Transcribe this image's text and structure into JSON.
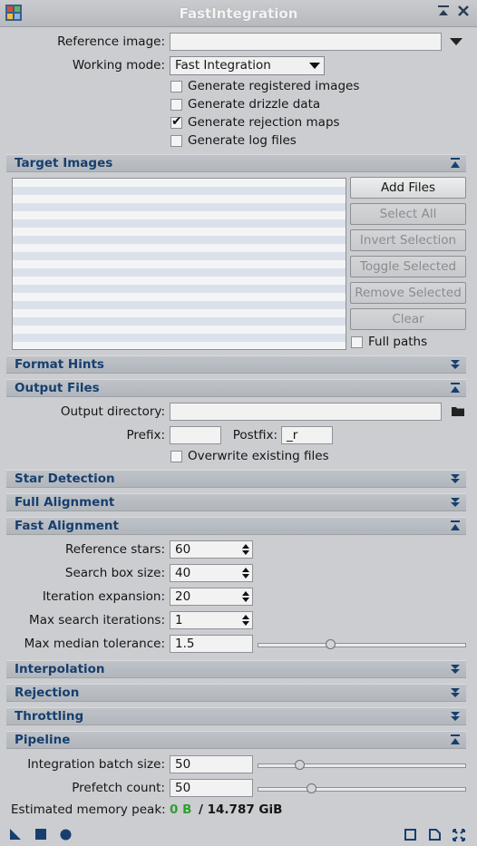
{
  "window": {
    "title": "FastIntegration",
    "accent": "#173f6e"
  },
  "form": {
    "reference_label": "Reference image:",
    "reference_value": "",
    "working_mode_label": "Working mode:",
    "working_mode_value": "Fast Integration",
    "options": [
      {
        "label": "Generate registered images",
        "checked": false
      },
      {
        "label": "Generate drizzle data",
        "checked": false
      },
      {
        "label": "Generate rejection maps",
        "checked": true
      },
      {
        "label": "Generate log files",
        "checked": false
      }
    ]
  },
  "sections": {
    "target_images": "Target Images",
    "format_hints": "Format Hints",
    "output_files": "Output Files",
    "star_detection": "Star Detection",
    "full_alignment": "Full Alignment",
    "fast_alignment": "Fast Alignment",
    "interpolation": "Interpolation",
    "rejection": "Rejection",
    "throttling": "Throttling",
    "pipeline": "Pipeline"
  },
  "target_images": {
    "buttons": {
      "add_files": "Add Files",
      "select_all": "Select All",
      "invert_selection": "Invert Selection",
      "toggle_selected": "Toggle Selected",
      "remove_selected": "Remove Selected",
      "clear": "Clear"
    },
    "full_paths_label": "Full paths",
    "full_paths_checked": false
  },
  "output_files": {
    "output_directory_label": "Output directory:",
    "output_directory_value": "",
    "prefix_label": "Prefix:",
    "prefix_value": "",
    "postfix_label": "Postfix:",
    "postfix_value": "_r",
    "overwrite_label": "Overwrite existing files",
    "overwrite_checked": false
  },
  "fast_alignment": {
    "reference_stars_label": "Reference stars:",
    "reference_stars_value": "60",
    "search_box_label": "Search box size:",
    "search_box_value": "40",
    "iteration_expansion_label": "Iteration expansion:",
    "iteration_expansion_value": "20",
    "max_search_iterations_label": "Max search iterations:",
    "max_search_iterations_value": "1",
    "max_median_tolerance_label": "Max median tolerance:",
    "max_median_tolerance_value": "1.5",
    "max_median_tolerance_slider": 0.35
  },
  "pipeline": {
    "batch_size_label": "Integration batch size:",
    "batch_size_value": "50",
    "batch_size_slider": 0.2,
    "prefetch_label": "Prefetch count:",
    "prefetch_value": "50",
    "prefetch_slider": 0.26,
    "memory_label": "Estimated memory peak:",
    "memory_used": "0 B",
    "memory_total": "/ 14.787 GiB",
    "memory_used_color": "#2fa02f"
  }
}
